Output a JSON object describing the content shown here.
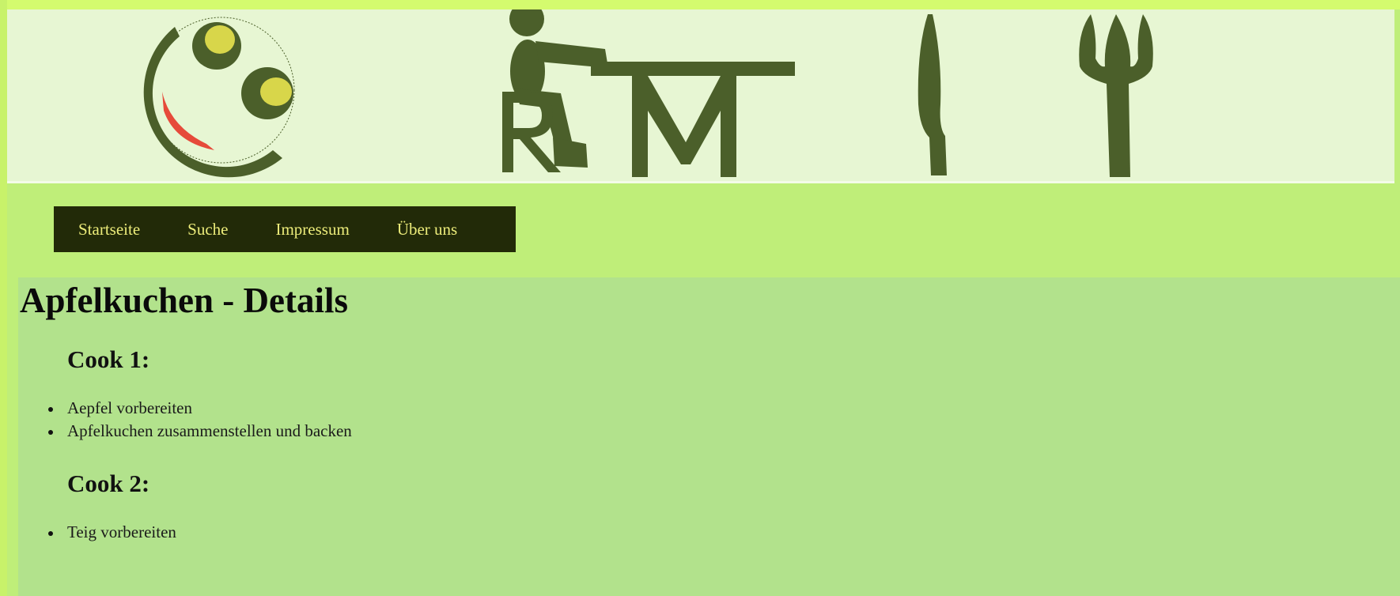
{
  "header": {
    "logo_icon": "smiley-face-logo",
    "mascot_icon": "person-sitting-at-table-rm-logo",
    "knife_icon": "knife-icon",
    "fork_icon": "fork-icon",
    "logo_letters": "RM",
    "colors": {
      "banner_bg": "#e7f6d3",
      "logo_green": "#4b5f2a",
      "logo_yellow": "#d8d64a",
      "logo_red": "#e64a3a"
    }
  },
  "nav": {
    "items": [
      {
        "label": "Startseite"
      },
      {
        "label": "Suche"
      },
      {
        "label": "Impressum"
      },
      {
        "label": "Über uns"
      }
    ],
    "colors": {
      "bg": "#222a08",
      "text": "#ecec7a"
    }
  },
  "main": {
    "title": "Apfelkuchen - Details",
    "cooks": [
      {
        "heading": "Cook 1:",
        "steps": [
          "Aepfel vorbereiten",
          "Apfelkuchen zusammenstellen und backen"
        ]
      },
      {
        "heading": "Cook 2:",
        "steps": [
          "Teig vorbereiten"
        ]
      }
    ]
  },
  "colors": {
    "page_bg": "#bfee79",
    "content_bg": "#b2e28c"
  }
}
